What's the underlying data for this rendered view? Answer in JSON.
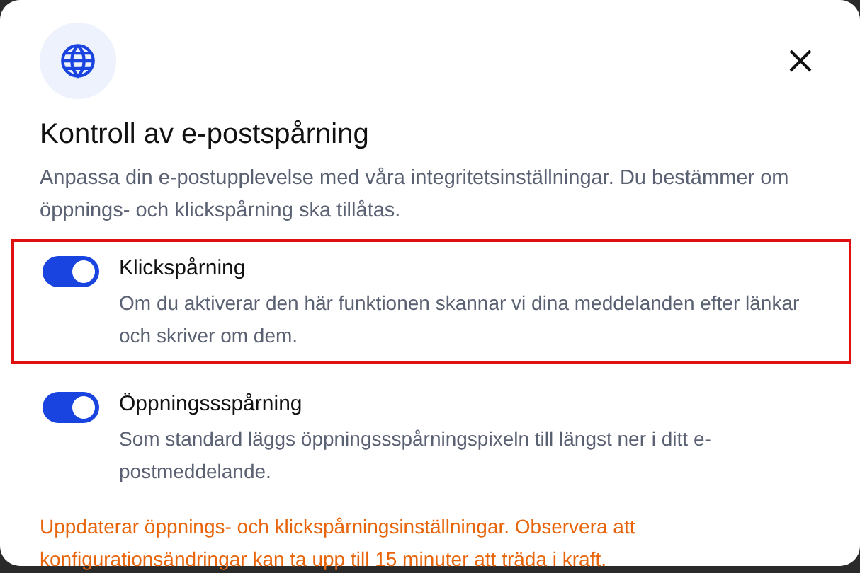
{
  "dialog": {
    "title": "Kontroll av e-postspårning",
    "description": "Anpassa din e-postupplevelse med våra integritetsinställningar. Du bestämmer om öppnings- och klickspårning ska tillåtas.",
    "options": [
      {
        "label": "Klickspårning",
        "description": "Om du aktiverar den här funktionen skannar vi dina meddelanden efter länkar och skriver om dem.",
        "on": true,
        "highlighted": true
      },
      {
        "label": "Öppningssspårning",
        "description": "Som standard läggs öppningssspårningspixeln till längst ner i ditt e-postmeddelande.",
        "on": true,
        "highlighted": false
      }
    ],
    "notice": "Uppdaterar öppnings- och klickspårningsinställningar. Observera att konfigurationsändringar kan ta upp till 15 minuter att träda i kraft."
  }
}
